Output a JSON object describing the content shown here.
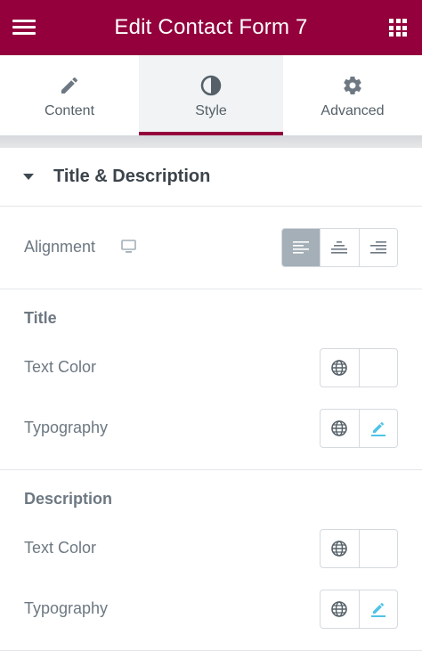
{
  "header": {
    "title": "Edit Contact Form 7",
    "menu_icon": "hamburger-icon",
    "apps_icon": "grid-icon",
    "background": "#93003c"
  },
  "tabs": [
    {
      "label": "Content",
      "icon": "pencil-icon",
      "active": false
    },
    {
      "label": "Style",
      "icon": "half-circle-icon",
      "active": true
    },
    {
      "label": "Advanced",
      "icon": "gear-icon",
      "active": false
    }
  ],
  "section": {
    "title": "Title & Description",
    "expanded": true
  },
  "alignment": {
    "label": "Alignment",
    "device_icon": "desktop-icon",
    "options": [
      "align-left-icon",
      "align-center-icon",
      "align-right-icon"
    ],
    "selected": "align-left-icon"
  },
  "title_group": {
    "heading": "Title",
    "text_color_label": "Text Color",
    "typography_label": "Typography"
  },
  "description_group": {
    "heading": "Description",
    "text_color_label": "Text Color",
    "typography_label": "Typography"
  },
  "colors": {
    "accent": "#93003c",
    "edit_icon": "#4fc3e6",
    "active_align": "#a4afb7"
  }
}
